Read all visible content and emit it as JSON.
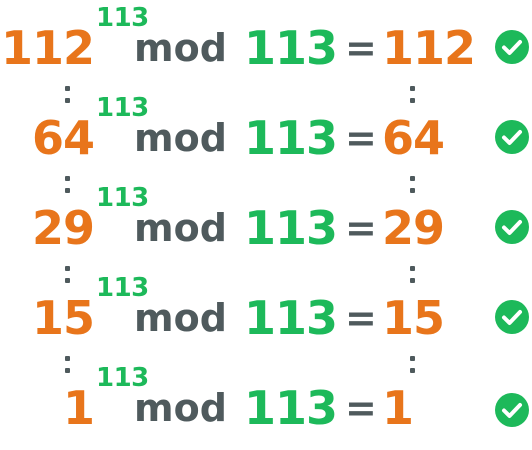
{
  "colors": {
    "base": "#e8751b",
    "accent": "#1db95a",
    "text": "#4f5a5d",
    "check": "#1db95a"
  },
  "operator_mod": "mod",
  "operator_eq": "=",
  "rows": [
    {
      "base": "112",
      "exponent": "113",
      "modulus": "113",
      "result": "112",
      "status_icon": "check-circle-icon"
    },
    {
      "base": "64",
      "exponent": "113",
      "modulus": "113",
      "result": "64",
      "status_icon": "check-circle-icon"
    },
    {
      "base": "29",
      "exponent": "113",
      "modulus": "113",
      "result": "29",
      "status_icon": "check-circle-icon"
    },
    {
      "base": "15",
      "exponent": "113",
      "modulus": "113",
      "result": "15",
      "status_icon": "check-circle-icon"
    },
    {
      "base": "1",
      "exponent": "113",
      "modulus": "113",
      "result": "1",
      "status_icon": "check-circle-icon"
    }
  ]
}
